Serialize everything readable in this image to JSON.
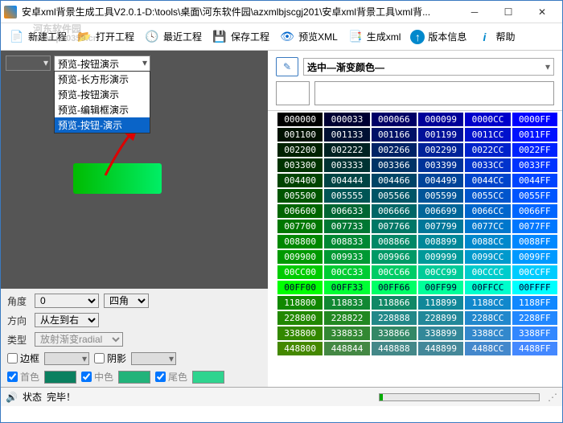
{
  "window": {
    "title": "安卓xml背景生成工具V2.0.1-D:\\tools\\桌面\\河东软件园\\azxmlbjscgj201\\安卓xml背景工具\\xml背..."
  },
  "watermark": {
    "name": "河东软件园",
    "url": "www.pc0359.cn"
  },
  "toolbar": {
    "new": "新建工程",
    "open": "打开工程",
    "recent": "最近工程",
    "save": "保存工程",
    "preview": "预览XML",
    "gen": "生成xml",
    "version": "版本信息",
    "help": "帮助"
  },
  "dropdown": {
    "selected": "预览-按钮演示",
    "items": [
      "预览-长方形演示",
      "预览-按钮演示",
      "预览-编辑框演示",
      "预览-按钮-演示"
    ]
  },
  "leftpanel": {
    "angle_lbl": "角度",
    "angle_val": "0",
    "corner": "四角",
    "dir_lbl": "方向",
    "dir_val": "从左到右",
    "type_lbl": "类型",
    "type_val": "放射渐变radial",
    "border": "边框",
    "shadow": "阴影",
    "c1": "首色",
    "c2": "中色",
    "c3": "尾色"
  },
  "rightpanel": {
    "select_label": "选中—渐变颜色—"
  },
  "palette_rows": [
    [
      "000000",
      "000033",
      "000066",
      "000099",
      "0000CC",
      "0000FF"
    ],
    [
      "001100",
      "001133",
      "001166",
      "001199",
      "0011CC",
      "0011FF"
    ],
    [
      "002200",
      "002222",
      "002266",
      "002299",
      "0022CC",
      "0022FF"
    ],
    [
      "003300",
      "003333",
      "003366",
      "003399",
      "0033CC",
      "0033FF"
    ],
    [
      "004400",
      "004444",
      "004466",
      "004499",
      "0044CC",
      "0044FF"
    ],
    [
      "005500",
      "005555",
      "005566",
      "005599",
      "0055CC",
      "0055FF"
    ],
    [
      "006600",
      "006633",
      "006666",
      "006699",
      "0066CC",
      "0066FF"
    ],
    [
      "007700",
      "007733",
      "007766",
      "007799",
      "0077CC",
      "0077FF"
    ],
    [
      "008800",
      "008833",
      "008866",
      "008899",
      "0088CC",
      "0088FF"
    ],
    [
      "009900",
      "009933",
      "009966",
      "009999",
      "0099CC",
      "0099FF"
    ],
    [
      "00CC00",
      "00CC33",
      "00CC66",
      "00CC99",
      "00CCCC",
      "00CCFF"
    ],
    [
      "00FF00",
      "00FF33",
      "00FF66",
      "00FF99",
      "00FFCC",
      "00FFFF"
    ],
    [
      "118800",
      "118833",
      "118866",
      "118899",
      "1188CC",
      "1188FF"
    ],
    [
      "228800",
      "228822",
      "228888",
      "228899",
      "2288CC",
      "2288FF"
    ],
    [
      "338800",
      "338833",
      "338866",
      "338899",
      "3388CC",
      "3388FF"
    ],
    [
      "448800",
      "448844",
      "448888",
      "448899",
      "4488CC",
      "4488FF"
    ]
  ],
  "status": {
    "label": "状态",
    "text": "完毕！"
  }
}
